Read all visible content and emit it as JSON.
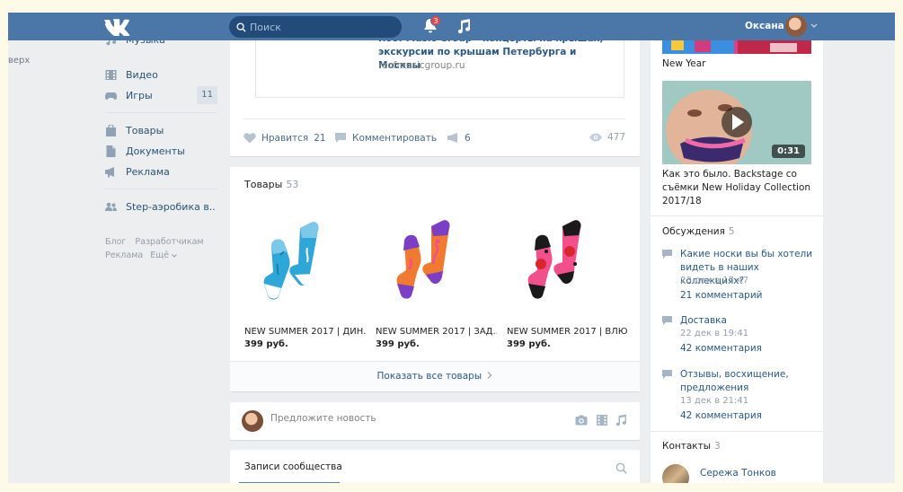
{
  "header": {
    "search_placeholder": "Поиск",
    "notifications_count": "3",
    "user_name": "Оксана"
  },
  "left_cut_text": "верх",
  "sidebar": {
    "items": [
      {
        "label": "Музыка",
        "icon": "music-icon"
      },
      {
        "label": "Видео",
        "icon": "video-icon"
      },
      {
        "label": "Игры",
        "icon": "gamepad-icon",
        "count": "11"
      },
      {
        "label": "Товары",
        "icon": "shopping-bag-icon"
      },
      {
        "label": "Документы",
        "icon": "document-icon"
      },
      {
        "label": "Реклама",
        "icon": "megaphone-icon"
      },
      {
        "label": "Step-аэробика в..",
        "icon": "group-icon"
      }
    ],
    "footer": {
      "blog": "Блог",
      "developers": "Разработчикам",
      "ads": "Реклама",
      "more": "Ещё"
    }
  },
  "post": {
    "link_title": "Roof Music Group - концерты на крышах, экскурсии по крышам Петербурга и Москвы",
    "link_url": "roofmusicgroup.ru",
    "like_label": "Нравится",
    "like_count": "21",
    "comment_label": "Комментировать",
    "repost_count": "6",
    "views": "477"
  },
  "goods": {
    "title": "Товары",
    "count": "53",
    "items": [
      {
        "name": "NEW SUMMER 2017 | ДИН...",
        "price": "399 руб.",
        "colors": {
          "base": "#2ea7d8",
          "accent": "#7cc8e8"
        }
      },
      {
        "name": "NEW SUMMER 2017 | ЗАД...",
        "price": "399 руб.",
        "colors": {
          "base": "#f07a30",
          "accent": "#7a3fc4"
        }
      },
      {
        "name": "NEW SUMMER 2017 | ВЛЮ...",
        "price": "399 руб.",
        "colors": {
          "base": "#f24f8d",
          "accent": "#1a1a1a"
        }
      }
    ],
    "show_all": "Показать все товары"
  },
  "suggest": {
    "placeholder": "Предложите новость"
  },
  "wall": {
    "tab": "Записи сообщества"
  },
  "right": {
    "album1_caption": "New Year",
    "video_duration": "0:31",
    "video_caption": "Как это было. Backstage со съёмки New Holiday Collection 2017/18",
    "discussions_title": "Обсуждения",
    "discussions_count": "5",
    "topics": [
      {
        "title": "Какие носки вы бы хотели видеть в наших коллекциях?",
        "date": "23 дек в 17:47",
        "comments": "21 комментарий"
      },
      {
        "title": "Доставка",
        "date": "22 дек в 19:41",
        "comments": "42 комментария"
      },
      {
        "title": "Отзывы, восхищение, предложения",
        "date": "13 дек в 21:41",
        "comments": "42 комментария"
      }
    ],
    "contacts_title": "Контакты",
    "contacts_count": "3",
    "contact_name": "Сережа Тонков"
  },
  "colors": {
    "header_bg": "#4a76a8",
    "link": "#2a5885",
    "page_bg": "#edeef0"
  }
}
